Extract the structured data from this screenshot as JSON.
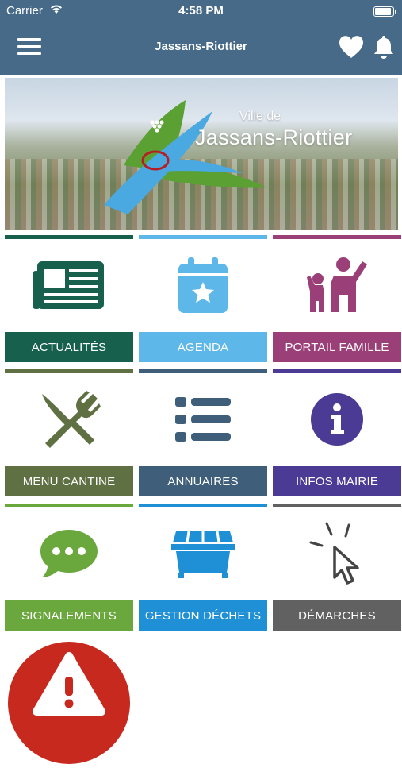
{
  "status": {
    "carrier": "Carrier",
    "time": "4:58 PM"
  },
  "header": {
    "title": "Jassans-Riottier",
    "menu_icon": "hamburger-menu-icon",
    "favorites_icon": "heart-icon",
    "notifications_icon": "bell-icon"
  },
  "banner": {
    "line1": "Ville de",
    "line2": "Jassans-Riottier"
  },
  "tiles": [
    {
      "label": "ACTUALITÉS",
      "color": "#17604e",
      "icon": "newspaper-icon"
    },
    {
      "label": "AGENDA",
      "color": "#5db7e8",
      "icon": "calendar-star-icon"
    },
    {
      "label": "PORTAIL FAMILLE",
      "color": "#9b3f78",
      "icon": "family-icon"
    },
    {
      "label": "MENU CANTINE",
      "color": "#5f7042",
      "icon": "cutlery-icon"
    },
    {
      "label": "ANNUAIRES",
      "color": "#3e5e79",
      "icon": "list-icon"
    },
    {
      "label": "INFOS MAIRIE",
      "color": "#4b3b94",
      "icon": "info-icon"
    },
    {
      "label": "SIGNALEMENTS",
      "color": "#6aa83e",
      "icon": "chat-bubble-icon"
    },
    {
      "label": "GESTION DÉCHETS",
      "color": "#1f8fd6",
      "icon": "dumpster-icon"
    },
    {
      "label": "DÉMARCHES",
      "color": "#616161",
      "icon": "pointer-click-icon"
    }
  ],
  "alert_icon": "warning-icon"
}
